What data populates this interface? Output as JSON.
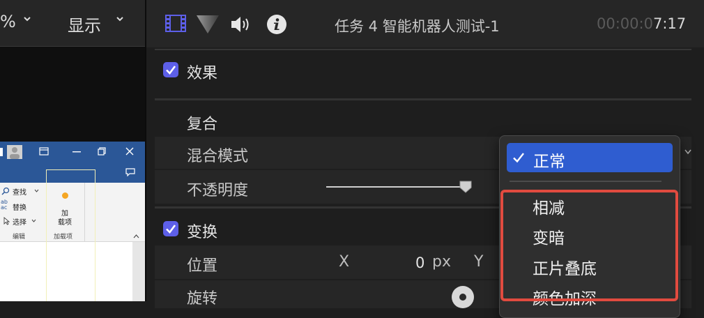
{
  "left_toolbar": {
    "zoom_fragment": "%",
    "display_label": "显示"
  },
  "word_window": {
    "find": "查找",
    "replace": "替换",
    "select": "选择",
    "editing_group": "编辑",
    "addin_line1": "加",
    "addin_line2": "载项",
    "addins_group": "加载项"
  },
  "inspector": {
    "title": "任务 4 智能机器人测试-1",
    "timecode_dim": "00:00:0",
    "timecode_bright": "7:17"
  },
  "effects": {
    "label": "效果",
    "checked": true
  },
  "composite": {
    "label": "复合",
    "blend_mode_label": "混合模式",
    "opacity_label": "不透明度"
  },
  "transform": {
    "label": "变换",
    "checked": true,
    "position_label": "位置",
    "x_label": "X",
    "x_value": "0",
    "x_unit": "px",
    "y_label": "Y",
    "rotation_label": "旋转"
  },
  "blend_menu": {
    "selected": "正常",
    "options": [
      "相减",
      "变暗",
      "正片叠底",
      "颜色加深"
    ]
  },
  "colors": {
    "accent_blue": "#2f5dd0",
    "checkbox_purple": "#5d5fe8",
    "highlight_red": "#e14b3f"
  }
}
